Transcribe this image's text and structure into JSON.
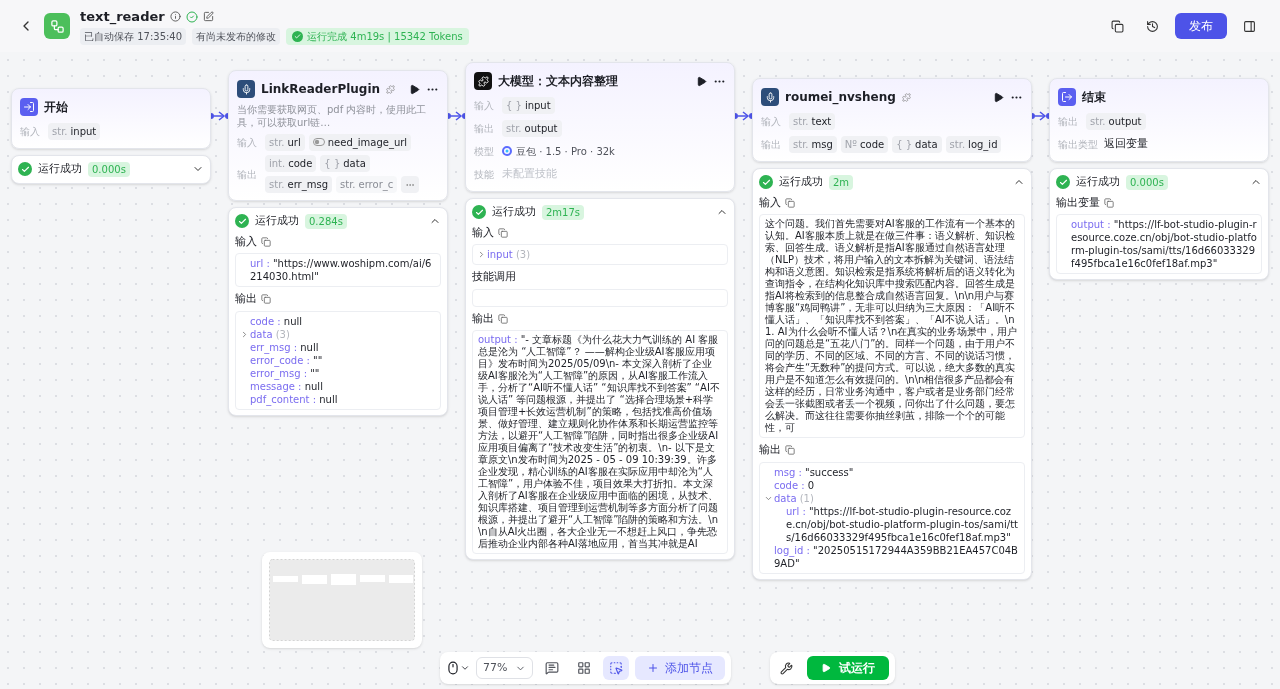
{
  "header": {
    "title": "text_reader",
    "saved": "已自动保存 17:35:40",
    "unpublished": "有尚未发布的修改",
    "run_status": "运行完成 4m19s | 15342 Tokens",
    "publish": "发布"
  },
  "nodes": [
    {
      "kind": "start",
      "title": "开始",
      "params": [
        {
          "kind": "tags",
          "label": "输入",
          "tags": [
            {
              "kind": "type",
              "prefix": "str.",
              "name": "input"
            }
          ]
        }
      ],
      "result": {
        "status": "运行成功",
        "time": "0.000s",
        "expanded": false
      }
    },
    {
      "kind": "plugin",
      "title": "LinkReaderPlugin",
      "badge": true,
      "actions": true,
      "description": "当你需要获取网页、pdf 内容时，使用此工具，可以获取url链…",
      "params": [
        {
          "kind": "tags",
          "label": "输入",
          "tags": [
            {
              "kind": "type",
              "prefix": "str.",
              "name": "url"
            },
            {
              "kind": "bool",
              "name": "need_image_url"
            }
          ]
        },
        {
          "kind": "tags",
          "label": "输出",
          "more": true,
          "tags": [
            {
              "kind": "type",
              "prefix": "int.",
              "name": "code"
            },
            {
              "kind": "type",
              "prefix": "{ }",
              "name": "data"
            },
            {
              "kind": "type",
              "prefix": "str.",
              "name": "err_msg"
            },
            {
              "kind": "type",
              "prefix": "str.",
              "name": "error_c",
              "faded": true
            }
          ]
        }
      ],
      "result": {
        "status": "运行成功",
        "time": "0.284s",
        "expanded": true,
        "sections": [
          {
            "kind": "tree",
            "title": "输入",
            "copy": true,
            "lines": [
              {
                "key": "url :",
                "value": "\"https://www.woshipm.com/ai/6214030.html\""
              }
            ]
          },
          {
            "kind": "tree",
            "title": "输出",
            "copy": true,
            "lines": [
              {
                "key": "code :",
                "value": "null"
              },
              {
                "key": "data",
                "count": "(3)",
                "expanded": false
              },
              {
                "key": "err_msg :",
                "value": "null"
              },
              {
                "key": "error_code :",
                "value": "\"\""
              },
              {
                "key": "error_msg :",
                "value": "\"\""
              },
              {
                "key": "message :",
                "value": "null"
              },
              {
                "key": "pdf_content :",
                "value": "null"
              }
            ]
          }
        ]
      }
    },
    {
      "kind": "llm",
      "title": "大模型：文本内容整理",
      "actions": true,
      "params": [
        {
          "kind": "tags",
          "label": "输入",
          "tags": [
            {
              "kind": "type",
              "prefix": "{ }",
              "name": "input"
            }
          ]
        },
        {
          "kind": "tags",
          "label": "输出",
          "tags": [
            {
              "kind": "type",
              "prefix": "str.",
              "name": "output"
            }
          ]
        },
        {
          "kind": "model",
          "label": "模型",
          "text": "豆包 · 1.5 · Pro · 32k"
        },
        {
          "kind": "text",
          "label": "技能",
          "text": "未配置技能",
          "muted": true
        }
      ],
      "result": {
        "status": "运行成功",
        "time": "2m17s",
        "expanded": true,
        "sections": [
          {
            "kind": "tree",
            "title": "输入",
            "copy": true,
            "lines": [
              {
                "key": "input",
                "count": "(3)",
                "expanded": false
              }
            ]
          },
          {
            "kind": "empty",
            "title": "技能调用"
          },
          {
            "kind": "text",
            "title": "输出",
            "copy": true,
            "key": "output :",
            "text": "\"- 文章标题《为什么花大力气训练的 AI 客服总是沦为 “人工智障”？ ——解构企业级AI客服应用项目》发布时间为2025/05/09\\n- 本文深入剖析了企业级AI客服沦为“人工智障”的原因，从AI客服工作流入手，分析了“AI听不懂人话” “知识库找不到答案” “AI不说人话” 等问题根源，并提出了 “选择合理场景+科学项目管理+长效运营机制”的策略，包括找准高价值场景、做好管理、建立规则化协作体系和长期运营监控等方法，以避开“人工智障”陷阱，同时指出很多企业级AI应用项目偏离了“技术改变生活”的初衷。\\n- 以下是文章原文\\n发布时间为2025 - 05 - 09 10:39:39。许多企业发现，精心训练的AI客服在实际应用中却沦为“人工智障”，用户体验不佳，项目效果大打折扣。本文深入剖析了AI客服在企业级应用中面临的困境，从技术、知识库搭建、项目管理到运营机制等多方面分析了问题根源，并提出了避开“人工智障”陷阱的策略和方法。\\n\\n自从AI火出圈，各大企业无一不想赶上风口，争先恐后推动企业内部各种AI落地应用，首当其冲就是AI"
          }
        ]
      }
    },
    {
      "kind": "plugin",
      "title": "roumei_nvsheng",
      "badge": true,
      "actions": true,
      "params": [
        {
          "kind": "tags",
          "label": "输入",
          "tags": [
            {
              "kind": "type",
              "prefix": "str.",
              "name": "text"
            }
          ]
        },
        {
          "kind": "tags",
          "label": "输出",
          "tags": [
            {
              "kind": "type",
              "prefix": "str.",
              "name": "msg"
            },
            {
              "kind": "type",
              "prefix": "Nº",
              "name": "code"
            },
            {
              "kind": "type",
              "prefix": "{ }",
              "name": "data"
            },
            {
              "kind": "type",
              "prefix": "str.",
              "name": "log_id"
            }
          ]
        }
      ],
      "result": {
        "status": "运行成功",
        "time": "2m",
        "expanded": true,
        "sections": [
          {
            "kind": "text",
            "title": "输入",
            "copy": true,
            "text": "这个问题。我们首先需要对AI客服的工作流有一个基本的认知。AI客服本质上就是在做三件事：语义解析、知识检索、回答生成。语义解析是指AI客服通过自然语言处理（NLP）技术，将用户输入的文本拆解为关键词、语法结构和语义意图。知识检索是指系统将解析后的语义转化为查询指令，在结构化知识库中搜索匹配内容。回答生成是指AI将检索到的信息整合成自然语言回复。\\n\\n用户与赛博客服“鸡同鸭讲”，无非可以归纳为三大原因：「AI听不懂人话」、「知识库找不到答案」、「AI不说人话」。\\n1. AI为什么会听不懂人话？\\n在真实的业务场景中，用户问的问题总是“五花八门”的。同样一个问题，由于用户不同的学历、不同的区域、不同的方言、不同的说话习惯，将会产生“无数种”的提问方式。可以说，绝大多数的真实用户是不知道怎么有效提问的。\\n\\n相信很多产品都会有这样的经历，日常业务沟通中，客户或者是业务部门经常会丢一张截图或者丢一个视频，问你出了什么问题，要怎么解决。而这往往需要你抽丝剥茧，排除一个个的可能性，可"
          },
          {
            "kind": "tree",
            "title": "输出",
            "copy": true,
            "lines": [
              {
                "key": "msg :",
                "value": "\"success\""
              },
              {
                "key": "code :",
                "value": "0"
              },
              {
                "key": "data",
                "count": "(1)",
                "expanded": true,
                "children": [
                  {
                    "key": "url :",
                    "value": "\"https://lf-bot-studio-plugin-resource.coze.cn/obj/bot-studio-platform-plugin-tos/sami/tts/16d66033329f495fbca1e16c0fef18af.mp3\""
                  }
                ]
              },
              {
                "key": "log_id :",
                "value": "\"20250515172944A359BB21EA457C04B9AD\""
              }
            ]
          }
        ]
      }
    },
    {
      "kind": "end",
      "title": "结束",
      "params": [
        {
          "kind": "tags",
          "label": "输出",
          "tags": [
            {
              "kind": "type",
              "prefix": "str.",
              "name": "output"
            }
          ]
        },
        {
          "kind": "text",
          "label": "输出类型",
          "text": "返回变量",
          "muted": false
        }
      ],
      "result": {
        "status": "运行成功",
        "time": "0.000s",
        "expanded": true,
        "sections": [
          {
            "kind": "tree",
            "title": "输出变量",
            "copy": true,
            "lines": [
              {
                "key": "output :",
                "value": "\"https://lf-bot-studio-plugin-resource.coze.cn/obj/bot-studio-platform-plugin-tos/sami/tts/16d66033329f495fbca1e16c0fef18af.mp3\""
              }
            ]
          }
        ]
      }
    }
  ],
  "toolbar": {
    "zoom": "77%",
    "tools": [
      {
        "kind": "comment",
        "selected": false
      },
      {
        "kind": "grid",
        "selected": false
      },
      {
        "kind": "minimap",
        "selected": true
      }
    ],
    "add_node": "添加节点",
    "test_run": "试运行"
  }
}
